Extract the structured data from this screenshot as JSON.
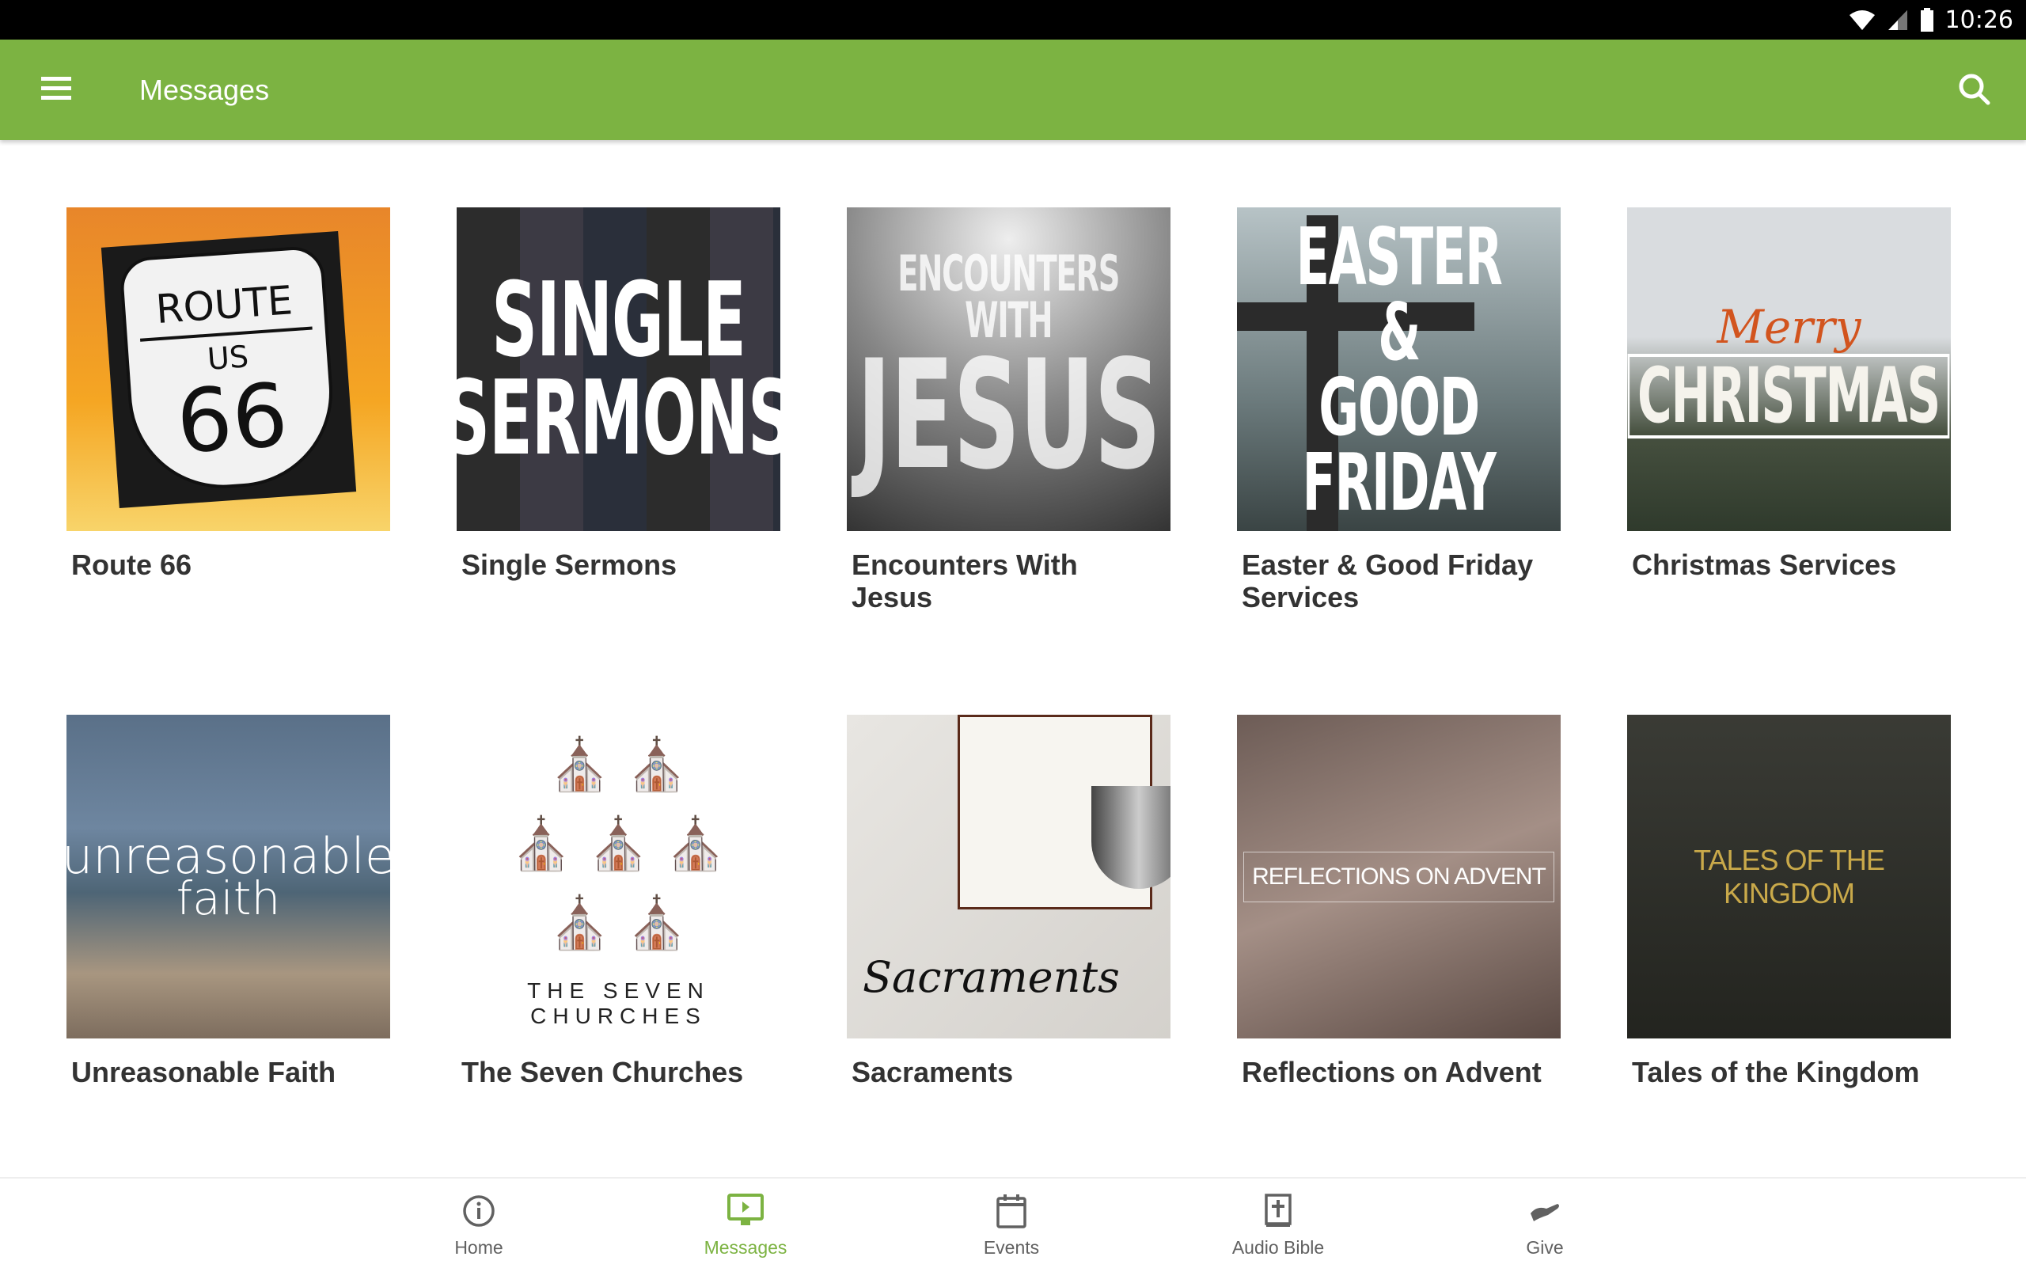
{
  "status_bar": {
    "time": "10:26",
    "icons": [
      "wifi-icon",
      "cell-signal-icon",
      "battery-icon"
    ]
  },
  "app_bar": {
    "title": "Messages",
    "menu_icon": "hamburger-menu-icon",
    "search_icon": "search-icon"
  },
  "series": [
    {
      "title": "Route 66",
      "art_lines": [
        "ROUTE",
        "US",
        "66"
      ]
    },
    {
      "title": "Single Sermons",
      "art_lines": [
        "SINGLE",
        "SERMONS"
      ]
    },
    {
      "title": "Encounters With Jesus",
      "art_lines": [
        "ENCOUNTERS WITH",
        "JESUS"
      ]
    },
    {
      "title": "Easter & Good Friday Services",
      "art_lines": [
        "EASTER &",
        "GOOD FRIDAY"
      ]
    },
    {
      "title": "Christmas Services",
      "art_lines": [
        "Merry",
        "CHRISTMAS"
      ]
    },
    {
      "title": "Unreasonable Faith",
      "art_lines": [
        "unreasonable",
        "faith"
      ]
    },
    {
      "title": "The Seven Churches",
      "art_lines": [
        "THE SEVEN CHURCHES"
      ]
    },
    {
      "title": "Sacraments",
      "art_lines": [
        "Sacraments"
      ]
    },
    {
      "title": "Reflections on Advent",
      "art_lines": [
        "REFLECTIONS ON ADVENT"
      ]
    },
    {
      "title": "Tales of the Kingdom",
      "art_lines": [
        "TALES OF THE KINGDOM"
      ]
    }
  ],
  "bottom_nav": [
    {
      "label": "Home",
      "icon": "info-icon",
      "active": false
    },
    {
      "label": "Messages",
      "icon": "tv-play-icon",
      "active": true
    },
    {
      "label": "Events",
      "icon": "calendar-icon",
      "active": false
    },
    {
      "label": "Audio Bible",
      "icon": "bible-icon",
      "active": false
    },
    {
      "label": "Give",
      "icon": "give-hand-icon",
      "active": false
    }
  ],
  "colors": {
    "accent": "#7cb342",
    "nav_inactive": "#616161",
    "title_text": "#333333"
  }
}
